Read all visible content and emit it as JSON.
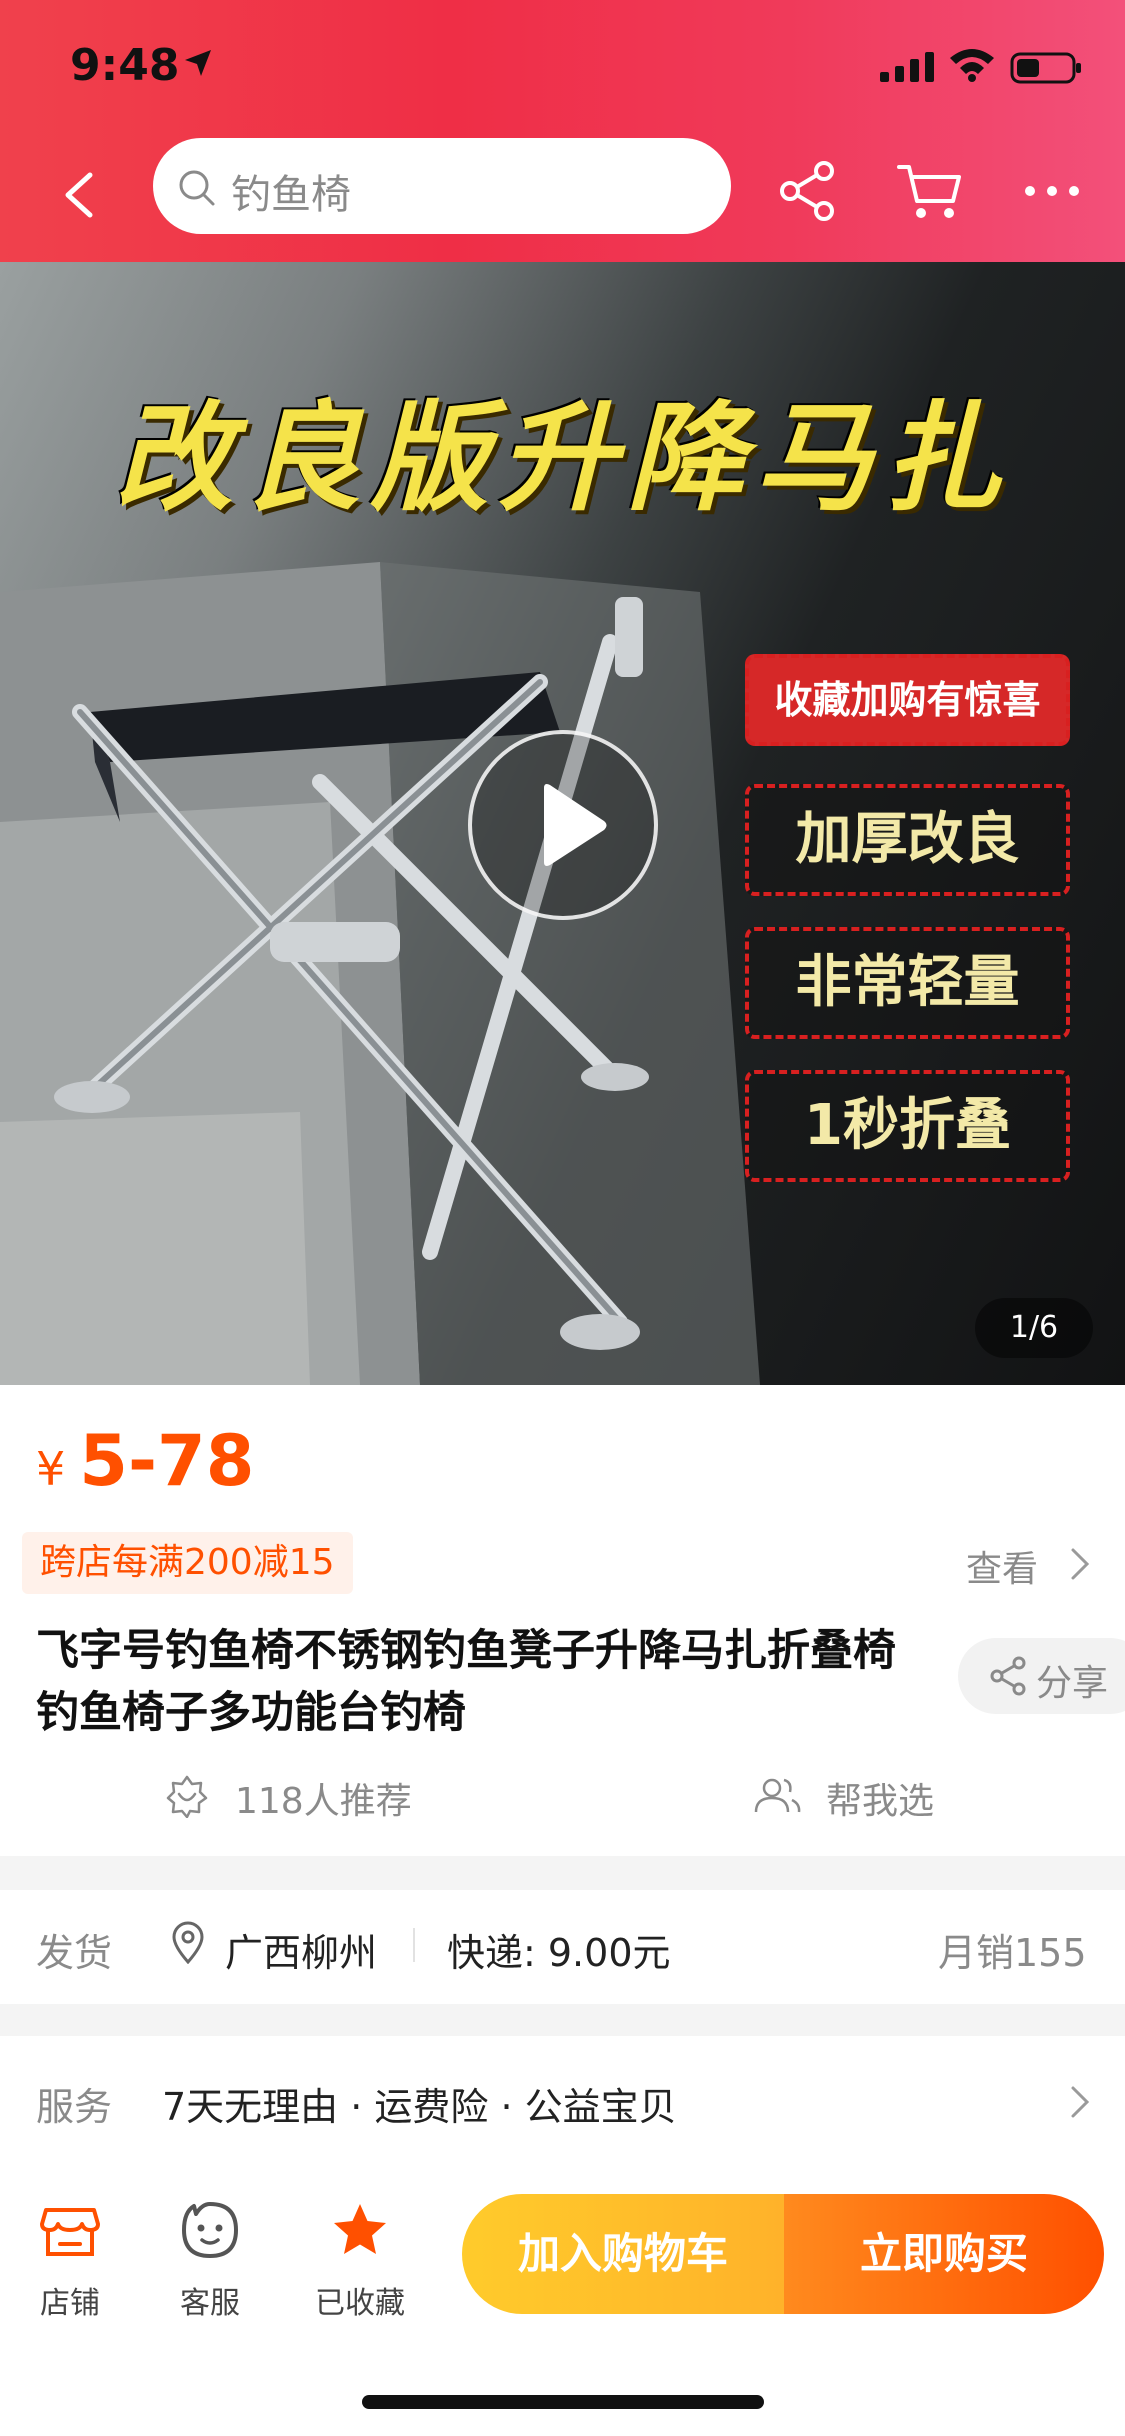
{
  "status_bar": {
    "time": "9:48"
  },
  "search": {
    "placeholder": "钓鱼椅"
  },
  "hero": {
    "title": "改良版升降马扎",
    "tags": [
      "收藏加购有惊喜",
      "加厚改良",
      "非常轻量",
      "1秒折叠"
    ],
    "page_indicator": "1/6"
  },
  "price": {
    "symbol": "¥",
    "value": "5-78"
  },
  "promo": {
    "badge": "跨店每满200减15",
    "view_label": "查看"
  },
  "product": {
    "title": "飞字号钓鱼椅不锈钢钓鱼凳子升降马扎折叠椅钓鱼椅子多功能台钓椅",
    "share_label": "分享",
    "recommend_text": "118人推荐",
    "help_choose_text": "帮我选"
  },
  "shipping": {
    "label": "发货",
    "origin": "广西柳州",
    "fee": "快递: 9.00元",
    "monthly_sales": "月销155"
  },
  "service": {
    "label": "服务",
    "items": "7天无理由 · 运费险 · 公益宝贝"
  },
  "bottom_bar": {
    "store_label": "店铺",
    "service_label": "客服",
    "favorite_label": "已收藏",
    "add_to_cart": "加入购物车",
    "buy_now": "立即购买"
  },
  "colors": {
    "header_red": "#ef2e46",
    "price_orange": "#ff5000",
    "cart_yellow": "#ffb22a",
    "buy_orange": "#ff5000"
  }
}
